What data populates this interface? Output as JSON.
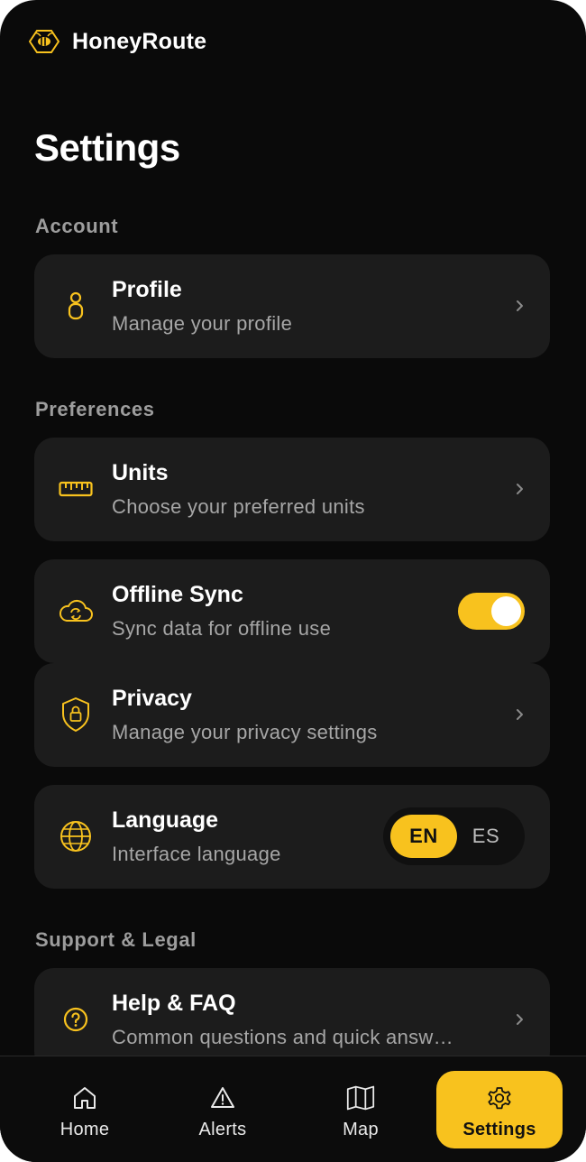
{
  "app": {
    "name": "HoneyRoute",
    "logo_icon": "bee-icon"
  },
  "page": {
    "title": "Settings"
  },
  "sections": {
    "account": "Account",
    "preferences": "Preferences",
    "support": "Support & Legal"
  },
  "items": {
    "profile": {
      "title": "Profile",
      "subtitle": "Manage your profile",
      "icon": "user-icon"
    },
    "units": {
      "title": "Units",
      "subtitle": "Choose your preferred units",
      "icon": "ruler-icon"
    },
    "offline_sync": {
      "title": "Offline Sync",
      "subtitle": "Sync data for offline use",
      "icon": "cloud-sync-icon",
      "enabled": true
    },
    "privacy": {
      "title": "Privacy",
      "subtitle": "Manage your privacy settings",
      "icon": "shield-lock-icon"
    },
    "language": {
      "title": "Language",
      "subtitle": "Interface language",
      "icon": "globe-icon",
      "options": [
        "EN",
        "ES"
      ],
      "selected": "EN"
    },
    "help": {
      "title": "Help & FAQ",
      "subtitle": "Common questions and quick answ…",
      "icon": "help-circle-icon"
    }
  },
  "tabs": [
    {
      "label": "Home",
      "icon": "home-icon"
    },
    {
      "label": "Alerts",
      "icon": "alert-triangle-icon"
    },
    {
      "label": "Map",
      "icon": "map-icon"
    },
    {
      "label": "Settings",
      "icon": "gear-icon",
      "active": true
    }
  ],
  "colors": {
    "accent": "#f8c21e",
    "background": "#0a0a0a",
    "card": "#1c1c1c",
    "muted_text": "#a6a6a6"
  }
}
